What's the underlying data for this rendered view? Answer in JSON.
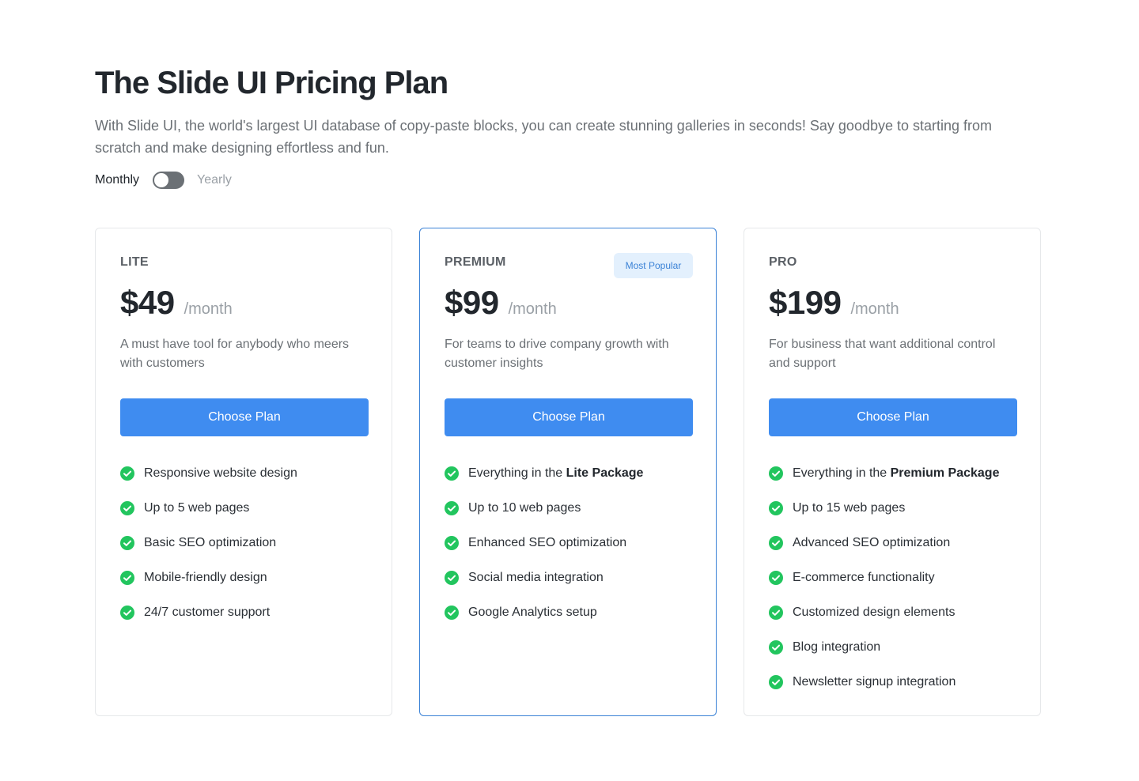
{
  "header": {
    "title": "The Slide UI Pricing Plan",
    "subtitle": "With Slide UI, the world's largest UI database of copy-paste blocks, you can create stunning galleries in seconds! Say goodbye to starting from scratch and make designing effortless and fun."
  },
  "billing": {
    "monthly_label": "Monthly",
    "yearly_label": "Yearly",
    "yearly_selected": false
  },
  "colors": {
    "accent": "#3f8cf0",
    "featured_border": "#3b82d6",
    "check": "#22c55e",
    "badge_bg": "#e3f0fd"
  },
  "plans": [
    {
      "name": "LITE",
      "price": "$49",
      "period": "/month",
      "description": "A must have tool for anybody who meers with customers",
      "button": "Choose Plan",
      "features": [
        {
          "pre": "Responsive website design",
          "bold": ""
        },
        {
          "pre": "Up to 5 web pages",
          "bold": ""
        },
        {
          "pre": "Basic SEO optimization",
          "bold": ""
        },
        {
          "pre": "Mobile-friendly design",
          "bold": ""
        },
        {
          "pre": "24/7 customer support",
          "bold": ""
        }
      ]
    },
    {
      "name": "PREMIUM",
      "badge": "Most Popular",
      "price": "$99",
      "period": "/month",
      "description": "For teams to drive company growth with customer insights",
      "button": "Choose Plan",
      "features": [
        {
          "pre": "Everything in the ",
          "bold": "Lite Package"
        },
        {
          "pre": "Up to 10 web pages",
          "bold": ""
        },
        {
          "pre": "Enhanced SEO optimization",
          "bold": ""
        },
        {
          "pre": "Social media integration",
          "bold": ""
        },
        {
          "pre": "Google Analytics setup",
          "bold": ""
        }
      ]
    },
    {
      "name": "PRO",
      "price": "$199",
      "period": "/month",
      "description": "For business that want additional control and support",
      "button": "Choose Plan",
      "features": [
        {
          "pre": "Everything in the ",
          "bold": "Premium Package"
        },
        {
          "pre": "Up to 15 web pages",
          "bold": ""
        },
        {
          "pre": "Advanced SEO optimization",
          "bold": ""
        },
        {
          "pre": "E-commerce functionality",
          "bold": ""
        },
        {
          "pre": "Customized design elements",
          "bold": ""
        },
        {
          "pre": "Blog integration",
          "bold": ""
        },
        {
          "pre": "Newsletter signup integration",
          "bold": ""
        }
      ]
    }
  ]
}
